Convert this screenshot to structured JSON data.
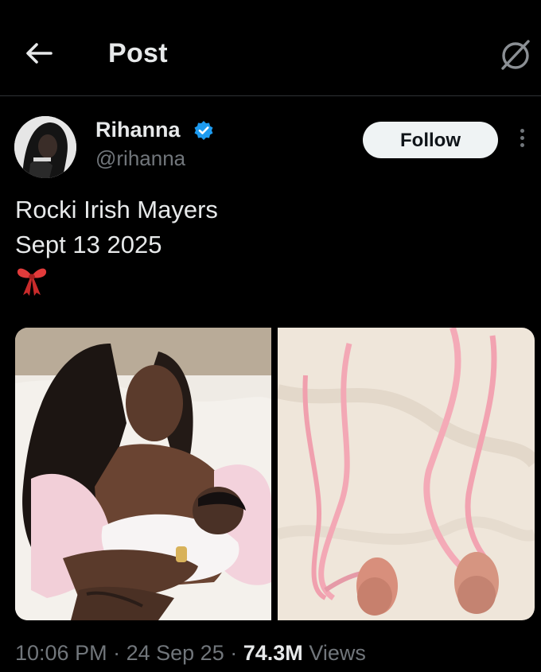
{
  "header": {
    "title": "Post",
    "back_icon": "arrow-left-icon",
    "grok_icon": "grok-icon"
  },
  "author": {
    "name": "Rihanna",
    "handle": "@rihanna",
    "verified": true,
    "verified_color": "#1d9bf0"
  },
  "follow_label": "Follow",
  "post": {
    "line1": "Rocki Irish Mayers",
    "line2": "Sept 13 2025",
    "emoji": "ribbon-bow-emoji"
  },
  "media": [
    {
      "name": "photo-mother-and-newborn"
    },
    {
      "name": "photo-pink-ribbon-baby-shoes"
    }
  ],
  "meta": {
    "time": "10:06 PM",
    "separator": "·",
    "date": "24 Sep 25",
    "views_count": "74.3M",
    "views_label": "Views"
  }
}
